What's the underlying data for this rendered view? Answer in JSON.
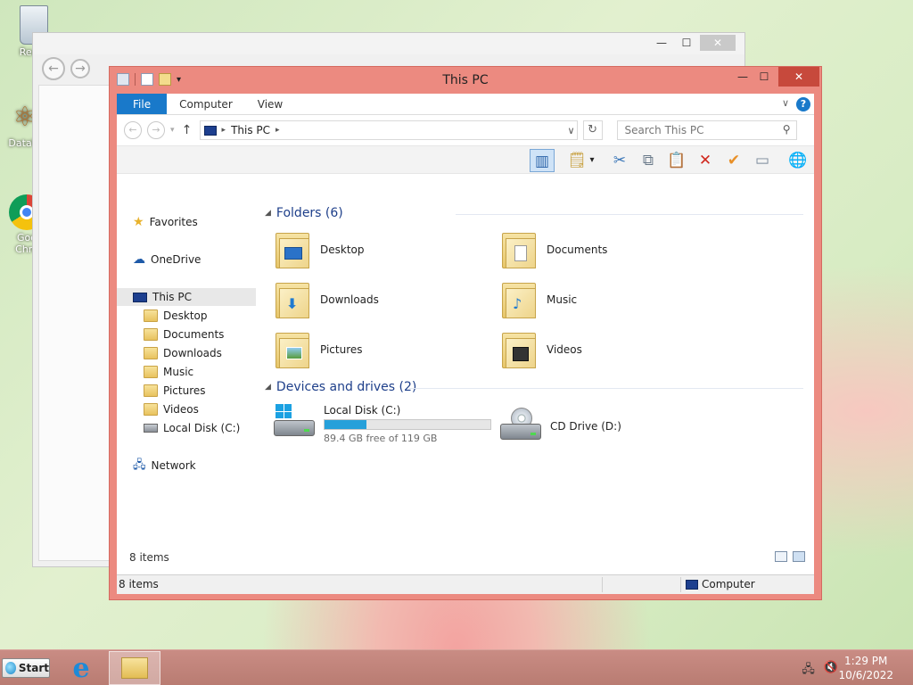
{
  "desktop": {
    "icons": [
      {
        "label": "Recyc"
      },
      {
        "label": "DataW"
      },
      {
        "label": "Goo Chro"
      }
    ]
  },
  "explorer": {
    "title": "This PC",
    "tabs": [
      {
        "label": "File"
      },
      {
        "label": "Computer"
      },
      {
        "label": "View"
      }
    ],
    "address": "This PC",
    "search_placeholder": "Search This PC",
    "nav": {
      "favorites": "Favorites",
      "onedrive": "OneDrive",
      "this_pc": "This PC",
      "children": [
        {
          "label": "Desktop"
        },
        {
          "label": "Documents"
        },
        {
          "label": "Downloads"
        },
        {
          "label": "Music"
        },
        {
          "label": "Pictures"
        },
        {
          "label": "Videos"
        },
        {
          "label": "Local Disk (C:)"
        }
      ],
      "network": "Network"
    },
    "folders_header": "Folders (6)",
    "folders": [
      {
        "label": "Desktop",
        "icon": "desktop-folder-icon"
      },
      {
        "label": "Documents",
        "icon": "documents-folder-icon"
      },
      {
        "label": "Downloads",
        "icon": "downloads-folder-icon"
      },
      {
        "label": "Music",
        "icon": "music-folder-icon"
      },
      {
        "label": "Pictures",
        "icon": "pictures-folder-icon"
      },
      {
        "label": "Videos",
        "icon": "videos-folder-icon"
      }
    ],
    "devices_header": "Devices and drives (2)",
    "drives": [
      {
        "label": "Local Disk (C:)",
        "free_text": "89.4 GB free of 119 GB",
        "used_fraction": 0.25
      },
      {
        "label": "CD Drive (D:)"
      }
    ],
    "item_count_inner": "8 items",
    "status_left": "8 items",
    "status_right": "Computer"
  },
  "taskbar": {
    "start_label": "Start",
    "time": "1:29 PM",
    "date": "10/6/2022"
  },
  "colors": {
    "explorer_frame": "#ec8a80",
    "accent": "#1979ca",
    "drive_bar": "#26a0da"
  }
}
